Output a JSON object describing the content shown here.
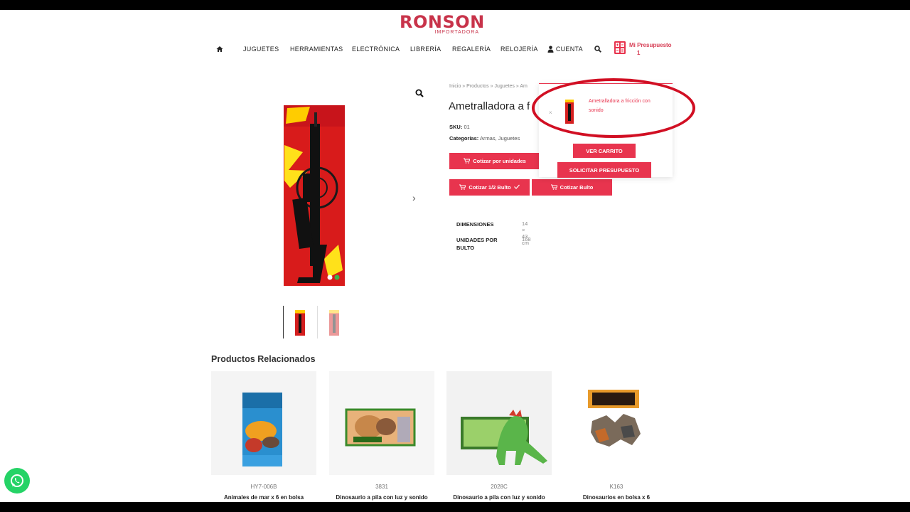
{
  "brand": {
    "name": "RONSON",
    "tagline": "IMPORTADORA",
    "accent_color": "#e8344e",
    "ellipse_color": "#d10f23"
  },
  "nav": {
    "home_icon": "home-icon",
    "items": [
      "JUGUETES",
      "HERRAMIENTAS",
      "ELECTRÓNICA",
      "LIBRERÍA",
      "REGALERÍA",
      "RELOJERÍA"
    ],
    "account_label": "CUENTA",
    "search_icon": "search-icon",
    "budget_label": "Mi Presupuesto",
    "budget_count": "1"
  },
  "product": {
    "breadcrumb": {
      "home": "Inicio",
      "sep": "»",
      "products": "Productos",
      "toys": "Juguetes",
      "current": "Am"
    },
    "title": "Ametralladora a fricción con sonido",
    "title_visible": "Ametralladora a f",
    "sku_label": "SKU:",
    "sku": "01",
    "categories_label": "Categorías:",
    "categories": [
      "Armas",
      "Juguetes"
    ],
    "buttons": {
      "by_units": "Cotizar por unidades",
      "half_bundle": "Cotizar 1/2 Bulto",
      "bundle": "Cotizar Bulto"
    },
    "specs": [
      {
        "label": "DIMENSIONES",
        "value": "14 × 43 cm"
      },
      {
        "label": "UNIDADES POR BULTO",
        "value": "168"
      }
    ]
  },
  "mini_cart": {
    "item_name": "Ametralladora a fricción con sonido",
    "remove_label": "×",
    "view_cart": "VER CARRITO",
    "request_budget": "SOLICITAR PRESUPUESTO"
  },
  "related": {
    "title": "Productos Relacionados",
    "items": [
      {
        "sku": "HY7-006B",
        "title": "Animales de mar x 6 en bolsa"
      },
      {
        "sku": "3831",
        "title": "Dinosaurio a pila con luz y sonido"
      },
      {
        "sku": "2028C",
        "title": "Dinosaurio a pila con luz y sonido"
      },
      {
        "sku": "K163",
        "title": "Dinosaurios en bolsa x 6"
      }
    ]
  },
  "whatsapp_icon": "whatsapp-icon"
}
